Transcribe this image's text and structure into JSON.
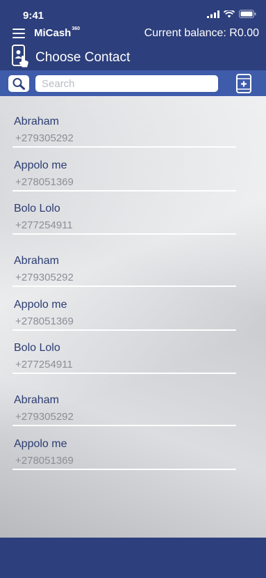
{
  "status_bar": {
    "time": "9:41"
  },
  "header": {
    "brand_name": "MiCash",
    "brand_superscript": "360",
    "balance_text": "Current balance: R0.00",
    "page_title": "Choose Contact"
  },
  "search": {
    "placeholder": "Search",
    "value": ""
  },
  "contacts": [
    {
      "name": "Abraham",
      "number": "+279305292"
    },
    {
      "name": "Appolo me",
      "number": "+278051369"
    },
    {
      "name": "Bolo Lolo",
      "number": "+277254911"
    },
    {
      "name": "Abraham",
      "number": "+279305292"
    },
    {
      "name": "Appolo me",
      "number": "+278051369"
    },
    {
      "name": "Bolo Lolo",
      "number": "+277254911"
    },
    {
      "name": "Abraham",
      "number": "+279305292"
    },
    {
      "name": "Appolo me",
      "number": "+278051369"
    }
  ],
  "icons": {
    "menu": "hamburger-menu-icon",
    "contact": "contact-phone-icon",
    "search": "search-icon",
    "add_contact": "add-contact-phone-icon"
  },
  "colors": {
    "header_bg": "#2d3f7c",
    "search_bar_bg": "#3f5cab",
    "contact_name": "#2c3c72",
    "contact_number": "#8a8e96",
    "divider": "#ffffff"
  }
}
